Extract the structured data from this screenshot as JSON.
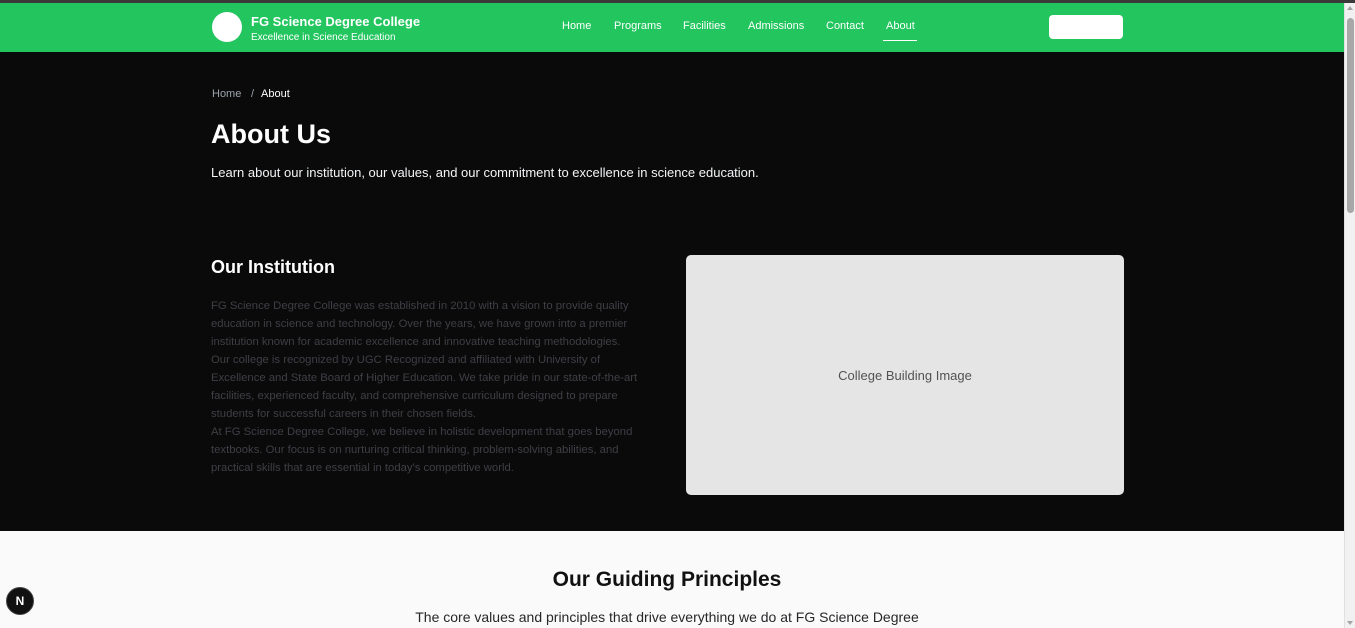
{
  "header": {
    "brand_name": "FG Science Degree College",
    "brand_tagline": "Excellence in Science Education",
    "nav": [
      "Home",
      "Programs",
      "Facilities",
      "Admissions",
      "Contact",
      "About"
    ],
    "active_nav": "About",
    "accent_color": "#22c55e"
  },
  "breadcrumb": {
    "home": "Home",
    "separator": "/",
    "current": "About"
  },
  "hero": {
    "title": "About Us",
    "subtitle": "Learn about our institution, our values, and our commitment to excellence in science education."
  },
  "institution": {
    "title": "Our Institution",
    "paragraphs": [
      "FG Science Degree College was established in 2010 with a vision to provide quality education in science and technology. Over the years, we have grown into a premier institution known for academic excellence and innovative teaching methodologies.",
      "Our college is recognized by UGC Recognized and affiliated with University of Excellence and State Board of Higher Education. We take pride in our state-of-the-art facilities, experienced faculty, and comprehensive curriculum designed to prepare students for successful careers in their chosen fields.",
      "At FG Science Degree College, we believe in holistic development that goes beyond textbooks. Our focus is on nurturing critical thinking, problem-solving abilities, and practical skills that are essential in today's competitive world."
    ],
    "image_placeholder": "College Building Image"
  },
  "principles": {
    "title": "Our Guiding Principles",
    "subtitle": "The core values and principles that drive everything we do at FG Science Degree"
  },
  "devtools_badge": "N"
}
